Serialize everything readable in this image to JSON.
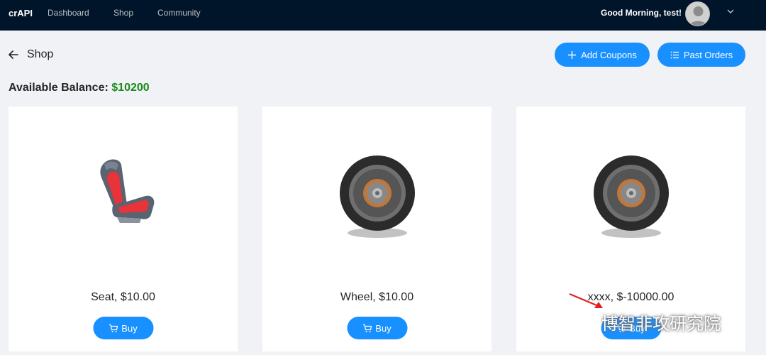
{
  "header": {
    "brand": "crAPI",
    "nav": [
      "Dashboard",
      "Shop",
      "Community"
    ],
    "greeting": "Good Morning, test!",
    "avatar_icon": "user-avatar",
    "menu_icon": "chevron-down-icon"
  },
  "page": {
    "title": "Shop",
    "back_icon": "arrow-left-icon"
  },
  "actions": {
    "add_coupons": "Add Coupons",
    "past_orders": "Past Orders"
  },
  "balance": {
    "label": "Available Balance",
    "separator": ":",
    "amount": "$10200"
  },
  "products": [
    {
      "name": "Seat, $10.00",
      "image": "car-seat",
      "buy": "Buy"
    },
    {
      "name": "Wheel, $10.00",
      "image": "wheel",
      "buy": "Buy"
    },
    {
      "name": "xxxx, $-10000.00",
      "image": "wheel",
      "buy": "Buy"
    }
  ],
  "watermark": {
    "text": "博智非攻研究院",
    "icon": "wechat-icon"
  },
  "colors": {
    "topbar": "#001529",
    "primary": "#1890ff",
    "balance_amount": "#1a8a1a",
    "background": "#f0f2f5",
    "annotation": "#e02020"
  }
}
